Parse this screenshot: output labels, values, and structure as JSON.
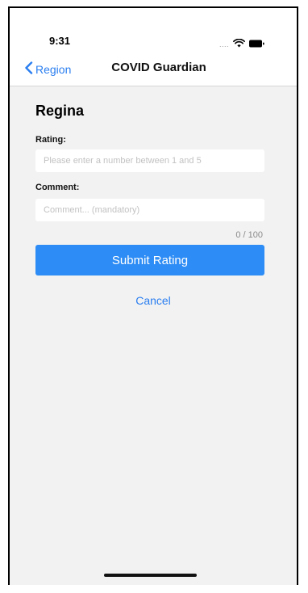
{
  "status_bar": {
    "time": "9:31",
    "signal_dots": "....",
    "icons": [
      "wifi-icon",
      "battery-icon"
    ]
  },
  "nav": {
    "back_label": "Region",
    "title": "COVID Guardian",
    "back_icon": "chevron-left-icon"
  },
  "form": {
    "place_name": "Regina",
    "rating_label": "Rating:",
    "rating_placeholder": "Please enter a number between 1 and 5",
    "rating_value": "",
    "comment_label": "Comment:",
    "comment_placeholder": "Comment... (mandatory)",
    "comment_value": "",
    "char_count": "0 / 100",
    "submit_label": "Submit Rating",
    "cancel_label": "Cancel"
  },
  "colors": {
    "accent": "#2a7ef0",
    "submit_bg": "#2d8cf5",
    "content_bg": "#f2f2f2"
  }
}
